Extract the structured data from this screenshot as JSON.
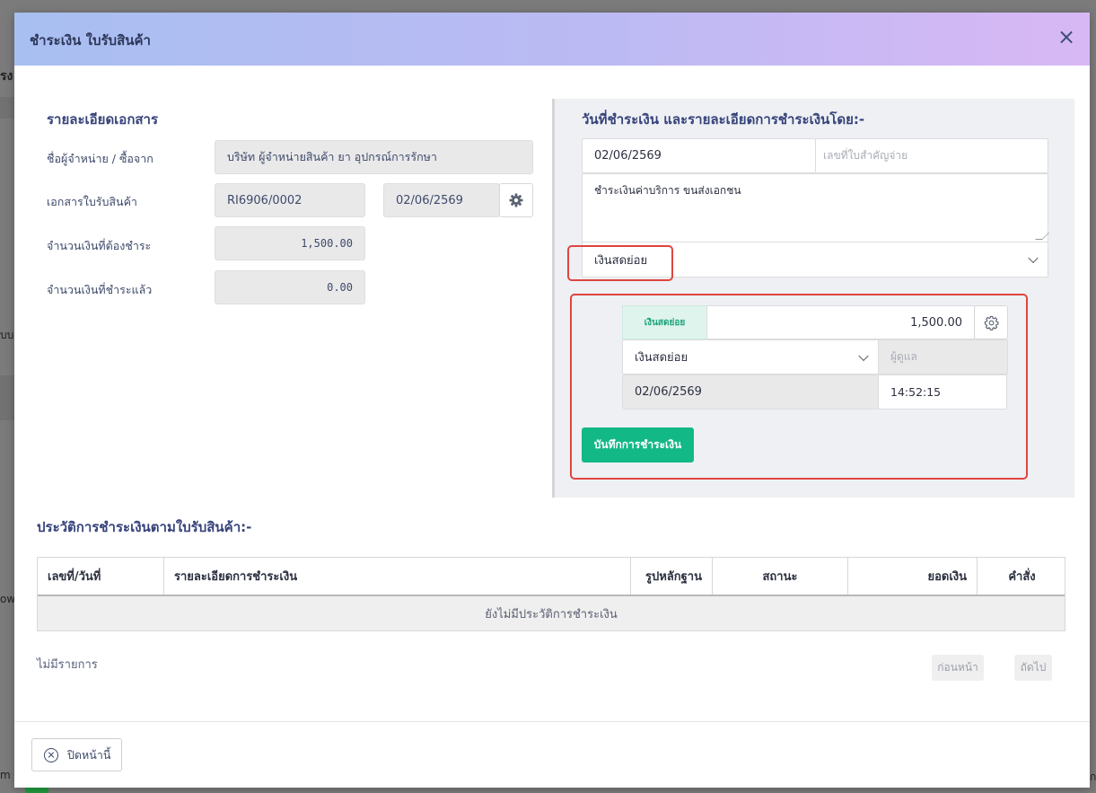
{
  "backdrop": {
    "frag1": "รง",
    "frag2": "บบ",
    "frag3": "owi",
    "frag4": "m",
    "frag5": "ก"
  },
  "modal": {
    "title": "ชำระเงิน ใบรับสินค้า",
    "close_glyph": "×"
  },
  "doc": {
    "heading": "รายละเอียดเอกสาร",
    "vendor_label": "ชื่อผู้จำหน่าย / ซื้อจาก",
    "vendor_value": "บริษัท ผู้จำหน่ายสินค้า ยา อุปกรณ์การรักษา",
    "receipt_label": "เอกสารใบรับสินค้า",
    "receipt_no": "RI6906/0002",
    "receipt_date": "02/06/2569",
    "amount_due_label": "จำนวนเงินที่ต้องชำระ",
    "amount_due": "1,500.00",
    "amount_paid_label": "จำนวนเงินที่ชำระแล้ว",
    "amount_paid": "0.00"
  },
  "payment": {
    "heading": "วันที่ชำระเงิน และรายละเอียดการชำระเงินโดย:-",
    "date": "02/06/2569",
    "voucher_placeholder": "เลขที่ใบสำคัญจ่าย",
    "note": "ชำระเงินค่าบริการ ขนส่งเอกชน",
    "method": "เงินสดย่อย",
    "line": {
      "tag": "เงินสดย่อย",
      "amount": "1,500.00",
      "fund": "เงินสดย่อย",
      "custodian_placeholder": "ผู้ดูแล",
      "date": "02/06/2569",
      "time": "14:52:15"
    },
    "save_label": "บันทึกการชำระเงิน"
  },
  "history": {
    "heading": "ประวัติการชำระเงินตามใบรับสินค้า:-",
    "columns": [
      "เลขที่/วันที่",
      "รายละเอียดการชำระเงิน",
      "รูปหลักฐาน",
      "สถานะ",
      "ยอดเงิน",
      "คำสั่ง"
    ],
    "empty_text": "ยังไม่มีประวัติการชำระเงิน",
    "no_items": "ไม่มีรายการ",
    "prev_label": "ก่อนหน้า",
    "next_label": "ถัดไป"
  },
  "footer": {
    "close_label": "ปิดหน้านี้"
  },
  "colors": {
    "accent_green": "#12b886",
    "highlight_red": "#e0453f",
    "header_gradient_start": "#a8bff2",
    "header_gradient_end": "#d8b8f4"
  }
}
